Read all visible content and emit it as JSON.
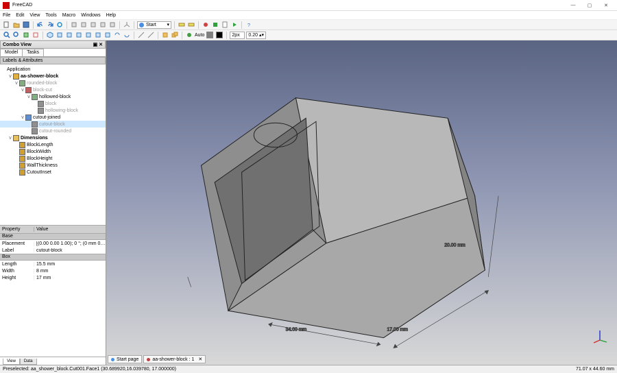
{
  "app_title": "FreeCAD",
  "menu": [
    "File",
    "Edit",
    "View",
    "Tools",
    "Macro",
    "Windows",
    "Help"
  ],
  "workbench": "Start",
  "auto_label": "Auto",
  "linewidth_label": "2px",
  "linewidth_value": "0.20",
  "combo_view": {
    "title": "Combo View",
    "tab1": "Model",
    "tab2": "Tasks",
    "sub": "Labels & Attributes"
  },
  "tree": {
    "root": "Application",
    "items": [
      {
        "ind": 1,
        "exp": "v",
        "ic": "doc",
        "label": "aa-shower-block",
        "bold": true
      },
      {
        "ind": 2,
        "exp": "v",
        "ic": "part",
        "label": "rounded-block",
        "grey": true
      },
      {
        "ind": 3,
        "exp": "v",
        "ic": "cut",
        "label": "block-cut",
        "grey": true
      },
      {
        "ind": 4,
        "exp": "v",
        "ic": "part",
        "label": "hollowed-block"
      },
      {
        "ind": 5,
        "exp": "",
        "ic": "box",
        "label": "block",
        "grey": true
      },
      {
        "ind": 5,
        "exp": "",
        "ic": "box",
        "label": "hollowing-block",
        "grey": true
      },
      {
        "ind": 3,
        "exp": "v",
        "ic": "fuse",
        "label": "cutout-joined"
      },
      {
        "ind": 4,
        "exp": "",
        "ic": "box",
        "label": "cutout-block",
        "sel": true,
        "grey": true
      },
      {
        "ind": 4,
        "exp": "",
        "ic": "box",
        "label": "cutout-rounded",
        "grey": true
      },
      {
        "ind": 1,
        "exp": "v",
        "ic": "folder",
        "label": "Dimensions",
        "bold": true
      },
      {
        "ind": 2,
        "exp": "",
        "ic": "dim",
        "label": "BlockLength"
      },
      {
        "ind": 2,
        "exp": "",
        "ic": "dim",
        "label": "BlockWidth"
      },
      {
        "ind": 2,
        "exp": "",
        "ic": "dim",
        "label": "BlockHeight"
      },
      {
        "ind": 2,
        "exp": "",
        "ic": "dim",
        "label": "WallThickness"
      },
      {
        "ind": 2,
        "exp": "",
        "ic": "dim",
        "label": "CutoutInset"
      }
    ]
  },
  "props": {
    "hdr_prop": "Property",
    "hdr_val": "Value",
    "sect1": "Base",
    "rows1": [
      {
        "k": "Placement",
        "v": "[(0.00 0.00 1.00); 0 °; (0 mm  0 mm  0 ..."
      },
      {
        "k": "Label",
        "v": "cutout-block"
      }
    ],
    "sect2": "Box",
    "rows2": [
      {
        "k": "Length",
        "v": "15.5 mm"
      },
      {
        "k": "Width",
        "v": "8 mm"
      },
      {
        "k": "Height",
        "v": "17 mm"
      }
    ],
    "btab1": "View",
    "btab2": "Data"
  },
  "docs": [
    {
      "label": "Start page",
      "color": "#4a90e2"
    },
    {
      "label": "aa-shower-block : 1",
      "color": "#c04040"
    }
  ],
  "dims": {
    "w": "34.00 mm",
    "h": "17.00 mm",
    "d": "20.00 mm"
  },
  "status_left": "Preselected: aa_shower_block.Cut001.Face1 (30.689920,16.039780, 17.000000)",
  "status_right": "71.07 x 44.60 mm",
  "icons": {
    "min": "—",
    "max": "▢",
    "close": "✕"
  }
}
